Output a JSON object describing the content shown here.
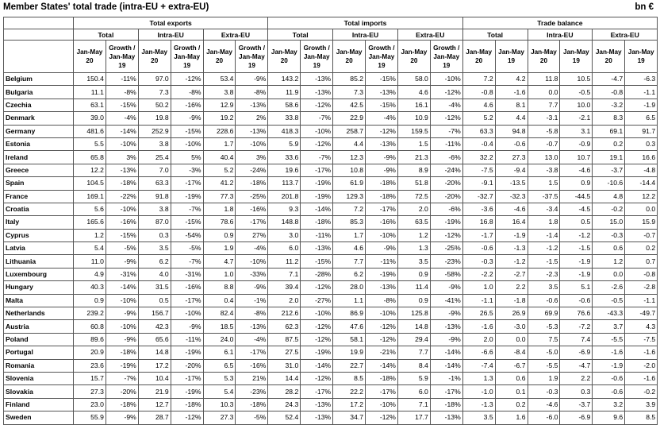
{
  "title": "Member States' total trade (intra-EU + extra-EU)",
  "unit": "bn €",
  "groups": [
    "Total exports",
    "Total imports",
    "Trade balance"
  ],
  "subgroups": [
    "Total",
    "Intra-EU",
    "Extra-EU",
    "Total",
    "Intra-EU",
    "Extra-EU",
    "Total",
    "Intra-EU",
    "Extra-EU"
  ],
  "cols": [
    "Jan-May 20",
    "Growth / Jan-May 19",
    "Jan-May 20",
    "Growth / Jan-May 19",
    "Jan-May 20",
    "Growth / Jan-May 19",
    "Jan-May 20",
    "Growth / Jan-May 19",
    "Jan-May 20",
    "Growth / Jan-May 19",
    "Jan-May 20",
    "Growth / Jan-May 19",
    "Jan-May 20",
    "Jan-May 19",
    "Jan-May 20",
    "Jan-May 19",
    "Jan-May 20",
    "Jan-May 19"
  ],
  "rows": [
    {
      "c": "Belgium",
      "v": [
        "150.4",
        "-11%",
        "97.0",
        "-12%",
        "53.4",
        "-9%",
        "143.2",
        "-13%",
        "85.2",
        "-15%",
        "58.0",
        "-10%",
        "7.2",
        "4.2",
        "11.8",
        "10.5",
        "-4.7",
        "-6.3"
      ]
    },
    {
      "c": "Bulgaria",
      "v": [
        "11.1",
        "-8%",
        "7.3",
        "-8%",
        "3.8",
        "-8%",
        "11.9",
        "-13%",
        "7.3",
        "-13%",
        "4.6",
        "-12%",
        "-0.8",
        "-1.6",
        "0.0",
        "-0.5",
        "-0.8",
        "-1.1"
      ]
    },
    {
      "c": "Czechia",
      "v": [
        "63.1",
        "-15%",
        "50.2",
        "-16%",
        "12.9",
        "-13%",
        "58.6",
        "-12%",
        "42.5",
        "-15%",
        "16.1",
        "-4%",
        "4.6",
        "8.1",
        "7.7",
        "10.0",
        "-3.2",
        "-1.9"
      ]
    },
    {
      "c": "Denmark",
      "v": [
        "39.0",
        "-4%",
        "19.8",
        "-9%",
        "19.2",
        "2%",
        "33.8",
        "-7%",
        "22.9",
        "-4%",
        "10.9",
        "-12%",
        "5.2",
        "4.4",
        "-3.1",
        "-2.1",
        "8.3",
        "6.5"
      ]
    },
    {
      "c": "Germany",
      "v": [
        "481.6",
        "-14%",
        "252.9",
        "-15%",
        "228.6",
        "-13%",
        "418.3",
        "-10%",
        "258.7",
        "-12%",
        "159.5",
        "-7%",
        "63.3",
        "94.8",
        "-5.8",
        "3.1",
        "69.1",
        "91.7"
      ]
    },
    {
      "c": "Estonia",
      "v": [
        "5.5",
        "-10%",
        "3.8",
        "-10%",
        "1.7",
        "-10%",
        "5.9",
        "-12%",
        "4.4",
        "-13%",
        "1.5",
        "-11%",
        "-0.4",
        "-0.6",
        "-0.7",
        "-0.9",
        "0.2",
        "0.3"
      ]
    },
    {
      "c": "Ireland",
      "v": [
        "65.8",
        "3%",
        "25.4",
        "5%",
        "40.4",
        "3%",
        "33.6",
        "-7%",
        "12.3",
        "-9%",
        "21.3",
        "-6%",
        "32.2",
        "27.3",
        "13.0",
        "10.7",
        "19.1",
        "16.6"
      ]
    },
    {
      "c": "Greece",
      "v": [
        "12.2",
        "-13%",
        "7.0",
        "-3%",
        "5.2",
        "-24%",
        "19.6",
        "-17%",
        "10.8",
        "-9%",
        "8.9",
        "-24%",
        "-7.5",
        "-9.4",
        "-3.8",
        "-4.6",
        "-3.7",
        "-4.8"
      ]
    },
    {
      "c": "Spain",
      "v": [
        "104.5",
        "-18%",
        "63.3",
        "-17%",
        "41.2",
        "-18%",
        "113.7",
        "-19%",
        "61.9",
        "-18%",
        "51.8",
        "-20%",
        "-9.1",
        "-13.5",
        "1.5",
        "0.9",
        "-10.6",
        "-14.4"
      ]
    },
    {
      "c": "France",
      "v": [
        "169.1",
        "-22%",
        "91.8",
        "-19%",
        "77.3",
        "-25%",
        "201.8",
        "-19%",
        "129.3",
        "-18%",
        "72.5",
        "-20%",
        "-32.7",
        "-32.3",
        "-37.5",
        "-44.5",
        "4.8",
        "12.2"
      ]
    },
    {
      "c": "Croatia",
      "v": [
        "5.6",
        "-10%",
        "3.8",
        "-7%",
        "1.8",
        "-16%",
        "9.3",
        "-14%",
        "7.2",
        "-17%",
        "2.0",
        "-6%",
        "-3.6",
        "-4.6",
        "-3.4",
        "-4.5",
        "-0.2",
        "0.0"
      ]
    },
    {
      "c": "Italy",
      "v": [
        "165.6",
        "-16%",
        "87.0",
        "-15%",
        "78.6",
        "-17%",
        "148.8",
        "-18%",
        "85.3",
        "-16%",
        "63.5",
        "-19%",
        "16.8",
        "16.4",
        "1.8",
        "0.5",
        "15.0",
        "15.9"
      ]
    },
    {
      "c": "Cyprus",
      "v": [
        "1.2",
        "-15%",
        "0.3",
        "-54%",
        "0.9",
        "27%",
        "3.0",
        "-11%",
        "1.7",
        "-10%",
        "1.2",
        "-12%",
        "-1.7",
        "-1.9",
        "-1.4",
        "-1.2",
        "-0.3",
        "-0.7"
      ]
    },
    {
      "c": "Latvia",
      "v": [
        "5.4",
        "-5%",
        "3.5",
        "-5%",
        "1.9",
        "-4%",
        "6.0",
        "-13%",
        "4.6",
        "-9%",
        "1.3",
        "-25%",
        "-0.6",
        "-1.3",
        "-1.2",
        "-1.5",
        "0.6",
        "0.2"
      ]
    },
    {
      "c": "Lithuania",
      "v": [
        "11.0",
        "-9%",
        "6.2",
        "-7%",
        "4.7",
        "-10%",
        "11.2",
        "-15%",
        "7.7",
        "-11%",
        "3.5",
        "-23%",
        "-0.3",
        "-1.2",
        "-1.5",
        "-1.9",
        "1.2",
        "0.7"
      ]
    },
    {
      "c": "Luxembourg",
      "v": [
        "4.9",
        "-31%",
        "4.0",
        "-31%",
        "1.0",
        "-33%",
        "7.1",
        "-28%",
        "6.2",
        "-19%",
        "0.9",
        "-58%",
        "-2.2",
        "-2.7",
        "-2.3",
        "-1.9",
        "0.0",
        "-0.8"
      ]
    },
    {
      "c": "Hungary",
      "v": [
        "40.3",
        "-14%",
        "31.5",
        "-16%",
        "8.8",
        "-9%",
        "39.4",
        "-12%",
        "28.0",
        "-13%",
        "11.4",
        "-9%",
        "1.0",
        "2.2",
        "3.5",
        "5.1",
        "-2.6",
        "-2.8"
      ]
    },
    {
      "c": "Malta",
      "v": [
        "0.9",
        "-10%",
        "0.5",
        "-17%",
        "0.4",
        "-1%",
        "2.0",
        "-27%",
        "1.1",
        "-8%",
        "0.9",
        "-41%",
        "-1.1",
        "-1.8",
        "-0.6",
        "-0.6",
        "-0.5",
        "-1.1"
      ]
    },
    {
      "c": "Netherlands",
      "v": [
        "239.2",
        "-9%",
        "156.7",
        "-10%",
        "82.4",
        "-8%",
        "212.6",
        "-10%",
        "86.9",
        "-10%",
        "125.8",
        "-9%",
        "26.5",
        "26.9",
        "69.9",
        "76.6",
        "-43.3",
        "-49.7"
      ]
    },
    {
      "c": "Austria",
      "v": [
        "60.8",
        "-10%",
        "42.3",
        "-9%",
        "18.5",
        "-13%",
        "62.3",
        "-12%",
        "47.6",
        "-12%",
        "14.8",
        "-13%",
        "-1.6",
        "-3.0",
        "-5.3",
        "-7.2",
        "3.7",
        "4.3"
      ]
    },
    {
      "c": "Poland",
      "v": [
        "89.6",
        "-9%",
        "65.6",
        "-11%",
        "24.0",
        "-4%",
        "87.5",
        "-12%",
        "58.1",
        "-12%",
        "29.4",
        "-9%",
        "2.0",
        "0.0",
        "7.5",
        "7.4",
        "-5.5",
        "-7.5"
      ]
    },
    {
      "c": "Portugal",
      "v": [
        "20.9",
        "-18%",
        "14.8",
        "-19%",
        "6.1",
        "-17%",
        "27.5",
        "-19%",
        "19.9",
        "-21%",
        "7.7",
        "-14%",
        "-6.6",
        "-8.4",
        "-5.0",
        "-6.9",
        "-1.6",
        "-1.6"
      ]
    },
    {
      "c": "Romania",
      "v": [
        "23.6",
        "-19%",
        "17.2",
        "-20%",
        "6.5",
        "-16%",
        "31.0",
        "-14%",
        "22.7",
        "-14%",
        "8.4",
        "-14%",
        "-7.4",
        "-6.7",
        "-5.5",
        "-4.7",
        "-1.9",
        "-2.0"
      ]
    },
    {
      "c": "Slovenia",
      "v": [
        "15.7",
        "-7%",
        "10.4",
        "-17%",
        "5.3",
        "21%",
        "14.4",
        "-12%",
        "8.5",
        "-18%",
        "5.9",
        "-1%",
        "1.3",
        "0.6",
        "1.9",
        "2.2",
        "-0.6",
        "-1.6"
      ]
    },
    {
      "c": "Slovakia",
      "v": [
        "27.3",
        "-20%",
        "21.9",
        "-19%",
        "5.4",
        "-23%",
        "28.2",
        "-17%",
        "22.2",
        "-17%",
        "6.0",
        "-17%",
        "-1.0",
        "0.1",
        "-0.3",
        "0.3",
        "-0.6",
        "-0.2"
      ]
    },
    {
      "c": "Finland",
      "v": [
        "23.0",
        "-18%",
        "12.7",
        "-18%",
        "10.3",
        "-18%",
        "24.3",
        "-13%",
        "17.2",
        "-10%",
        "7.1",
        "-18%",
        "-1.3",
        "0.2",
        "-4.6",
        "-3.7",
        "3.2",
        "3.9"
      ]
    },
    {
      "c": "Sweden",
      "v": [
        "55.9",
        "-9%",
        "28.7",
        "-12%",
        "27.3",
        "-5%",
        "52.4",
        "-13%",
        "34.7",
        "-12%",
        "17.7",
        "-13%",
        "3.5",
        "1.6",
        "-6.0",
        "-6.9",
        "9.6",
        "8.5"
      ]
    }
  ]
}
